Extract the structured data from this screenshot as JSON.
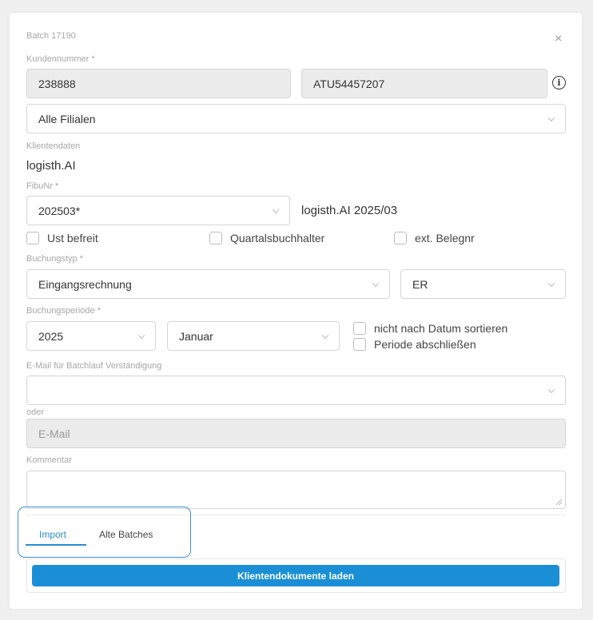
{
  "dialog": {
    "title": "Batch 17190",
    "close_symbol": "×"
  },
  "kundennummer": {
    "label": "Kundennummer *",
    "value": "238888",
    "uid_value": "ATU54457207",
    "info_symbol": "i"
  },
  "filialen": {
    "selected": "Alle Filialen"
  },
  "klientendaten": {
    "label": "Klientendaten",
    "value": "logisth.AI"
  },
  "fibu": {
    "label": "FibuNr *",
    "selected": "202503*",
    "description": "logisth.AI 2025/03"
  },
  "flags": {
    "ust_befreit": {
      "label": "Ust befreit",
      "checked": false
    },
    "quartalsbuchhalter": {
      "label": "Quartalsbuchhalter",
      "checked": false
    },
    "ext_belegnr": {
      "label": "ext. Belegnr",
      "checked": false
    }
  },
  "buchungstyp": {
    "label": "Buchungstyp *",
    "selected": "Eingangsrechnung",
    "code_selected": "ER"
  },
  "buchungsperiode": {
    "label": "Buchungsperiode *",
    "year": "2025",
    "month": "Januar",
    "nicht_sortieren": {
      "label": "nicht nach Datum sortieren",
      "checked": false
    },
    "abschliessen": {
      "label": "Periode abschließen",
      "checked": false
    }
  },
  "email": {
    "label": "E-Mail für Batchlauf Verständigung",
    "selected": "",
    "oder_label": "oder",
    "placeholder": "E-Mail"
  },
  "kommentar": {
    "label": "Kommentar",
    "value": ""
  },
  "tabs": [
    {
      "label": "Import",
      "active": true
    },
    {
      "label": "Alte Batches",
      "active": false
    }
  ],
  "actions": {
    "load_label": "Klientendokumente laden"
  },
  "colors": {
    "accent": "#1a8fd6",
    "tab_highlight_border": "#3d8fd6",
    "disabled_field": "#ececec"
  }
}
